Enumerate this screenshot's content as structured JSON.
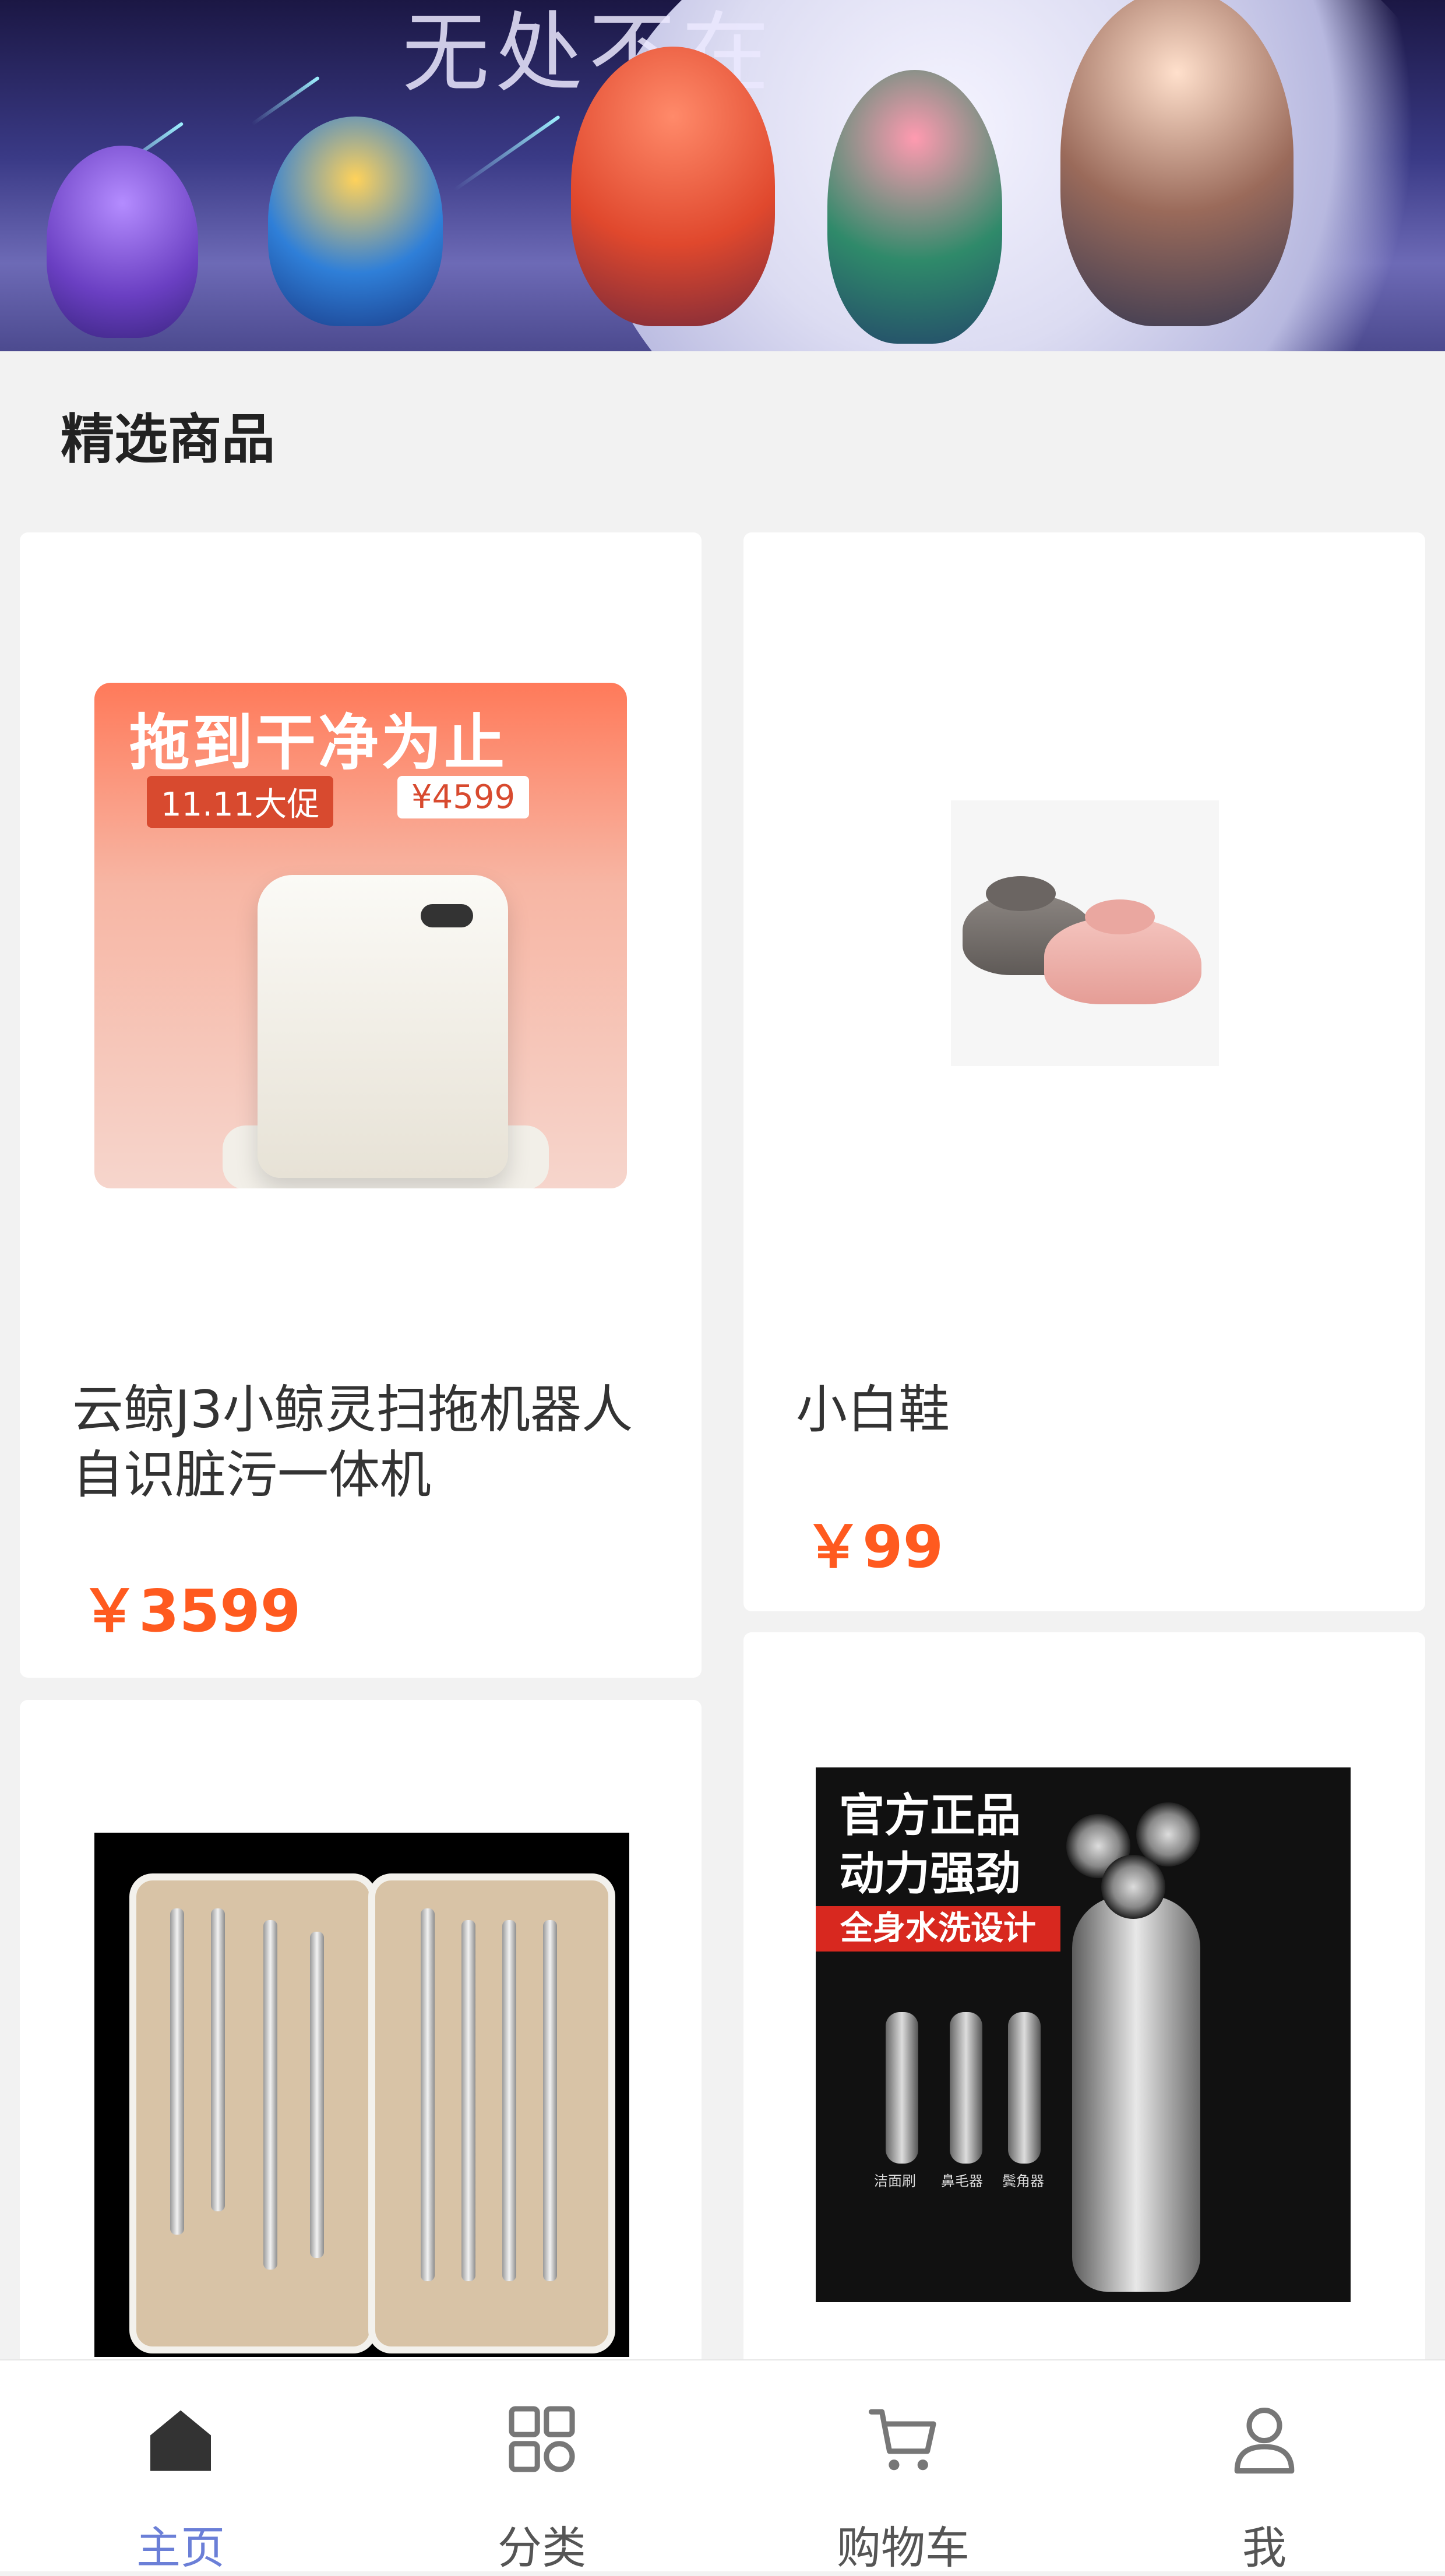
{
  "banner": {
    "text": "无处不在"
  },
  "section": {
    "title": "精选商品"
  },
  "products": [
    {
      "name": "云鲸J3小鲸灵扫拖机器人自识脏污一体机",
      "price": "￥3599",
      "image_text": {
        "headline": "拖到干净为止",
        "tag1": "11.11大促",
        "tag2": "¥4599"
      }
    },
    {
      "name": "小白鞋",
      "price": "￥99"
    },
    {
      "name": "",
      "price": ""
    },
    {
      "name": "",
      "price": "",
      "image_text": {
        "line1": "官方正品",
        "line2": "动力强劲",
        "banner": "全身水洗设计",
        "l1": "洁面刷",
        "l2": "鼻毛器",
        "l3": "鬓角器"
      }
    }
  ],
  "tabbar": {
    "items": [
      {
        "label": "主页",
        "icon": "home-icon",
        "active": true
      },
      {
        "label": "分类",
        "icon": "grid-icon",
        "active": false
      },
      {
        "label": "购物车",
        "icon": "cart-icon",
        "active": false
      },
      {
        "label": "我",
        "icon": "user-icon",
        "active": false
      }
    ],
    "active_color": "#6b7fd7",
    "inactive_color": "#555555"
  },
  "colors": {
    "price": "#ff5a1f",
    "background": "#f2f2f2"
  }
}
